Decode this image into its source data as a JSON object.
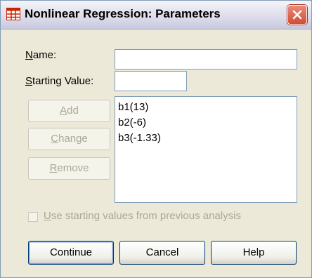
{
  "window": {
    "title": "Nonlinear Regression: Parameters",
    "icon": "table-grid-icon",
    "close_icon": "close-icon"
  },
  "fields": {
    "name_label": "Name:",
    "name_mnemonic": "N",
    "name_rest": "ame:",
    "name_value": "",
    "starting_label": "Starting Value:",
    "starting_mnemonic": "S",
    "starting_rest": "tarting Value:",
    "starting_value": ""
  },
  "buttons": {
    "add": {
      "mnemonic": "A",
      "rest": "dd"
    },
    "change": {
      "mnemonic": "C",
      "rest": "hange"
    },
    "remove": {
      "mnemonic": "R",
      "rest": "emove"
    }
  },
  "parameters": [
    "b1(13)",
    "b2(-6)",
    "b3(-1.33)"
  ],
  "checkbox": {
    "mnemonic": "U",
    "rest": "se starting values from previous analysis",
    "checked": false
  },
  "actions": {
    "continue": "Continue",
    "cancel": "Cancel",
    "help": "Help"
  },
  "colors": {
    "dialog_bg": "#ece9d8",
    "close_red": "#d24d33",
    "disabled_text": "#aca899",
    "icon_red": "#cc2200"
  }
}
